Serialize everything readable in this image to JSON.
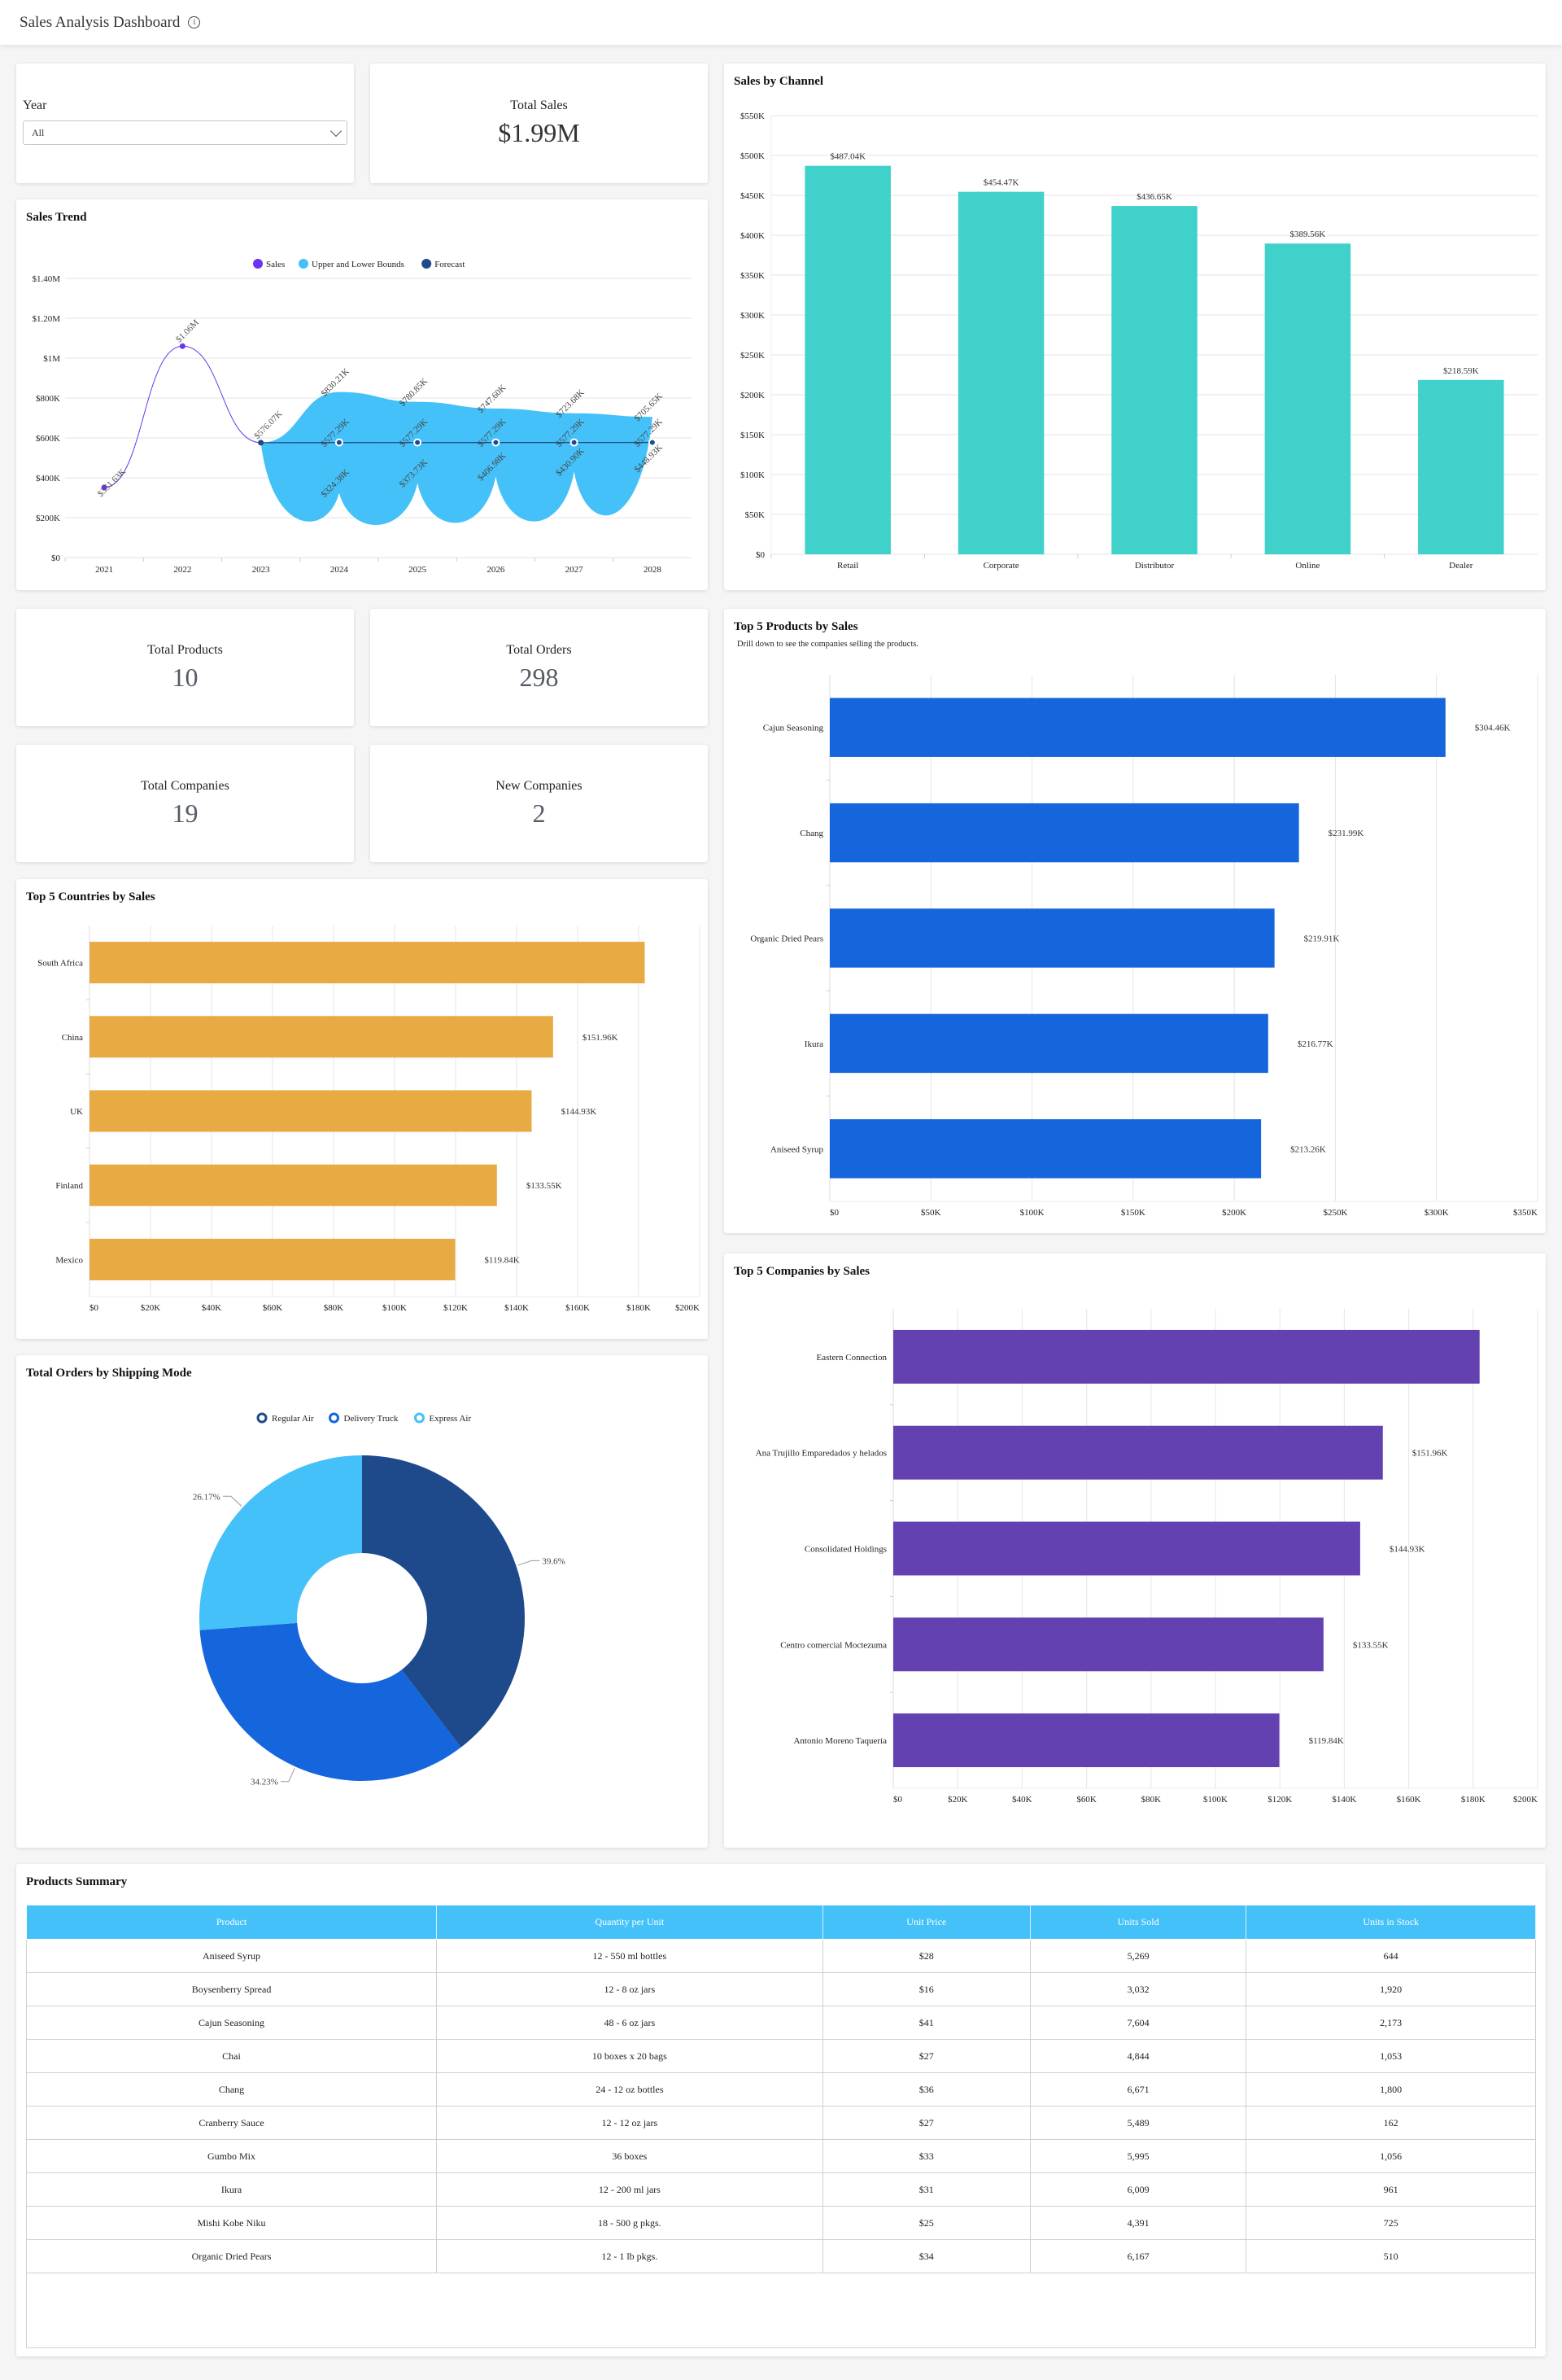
{
  "header": {
    "title": "Sales Analysis Dashboard",
    "info_icon": "info-icon"
  },
  "filter": {
    "label": "Year",
    "selected": "All"
  },
  "kpis": {
    "total_sales": {
      "label": "Total Sales",
      "value": "$1.99M"
    },
    "total_products": {
      "label": "Total Products",
      "value": "10"
    },
    "total_orders": {
      "label": "Total Orders",
      "value": "298"
    },
    "total_companies": {
      "label": "Total Companies",
      "value": "19"
    },
    "new_companies": {
      "label": "New Companies",
      "value": "2"
    }
  },
  "cards": {
    "sales_trend": "Sales Trend",
    "sales_by_channel": "Sales by Channel",
    "top_countries": "Top 5 Countries by Sales",
    "top_products": "Top 5 Products by Sales",
    "top_products_sub": "Drill down to see the companies selling the products.",
    "top_companies": "Top 5 Companies by Sales",
    "shipping_mode": "Total Orders by Shipping Mode",
    "products_summary": "Products Summary"
  },
  "colors": {
    "sales": "#6a35f0",
    "bounds": "#44c1f8",
    "forecast": "#1e4a8c",
    "channel": "#40d1cb",
    "countries": "#e8aa42",
    "products": "#1565dd",
    "companies": "#6441b0",
    "regular_air": "#1e4a8c",
    "delivery_truck": "#1565dd",
    "express_air": "#44c1f8",
    "table_header": "#44c1f8"
  },
  "chart_data": [
    {
      "id": "sales_trend",
      "type": "line",
      "title": "Sales Trend",
      "x": [
        "2021",
        "2022",
        "2023",
        "2024",
        "2025",
        "2026",
        "2027",
        "2028"
      ],
      "ylim": [
        0,
        1400000
      ],
      "yticks": [
        "$0",
        "$200K",
        "$400K",
        "$600K",
        "$800K",
        "$1M",
        "$1.20M",
        "$1.40M"
      ],
      "legend": [
        "Sales",
        "Upper and Lower Bounds",
        "Forecast"
      ],
      "legend_position": "top-center",
      "series": [
        {
          "name": "Sales",
          "values": [
            351630,
            1060000,
            576070,
            null,
            null,
            null,
            null,
            null
          ],
          "labels": [
            "$351.63K",
            "$1.06M",
            "$576.07K",
            "",
            "",
            "",
            "",
            ""
          ]
        },
        {
          "name": "Forecast",
          "values": [
            null,
            null,
            576070,
            577290,
            577290,
            577290,
            577290,
            577290
          ],
          "labels": [
            "",
            "",
            "",
            "$577.29K",
            "$577.29K",
            "$577.29K",
            "$577.29K",
            "$577.29K"
          ]
        },
        {
          "name": "Upper Bound",
          "values": [
            null,
            null,
            576070,
            830210,
            780850,
            747600,
            723680,
            705650
          ],
          "labels": [
            "",
            "",
            "",
            "$830.21K",
            "$780.85K",
            "$747.60K",
            "$723.68K",
            "$705.65K"
          ]
        },
        {
          "name": "Lower Bound",
          "values": [
            null,
            null,
            576070,
            324380,
            373730,
            406980,
            430900,
            448930
          ],
          "labels": [
            "",
            "",
            "",
            "$324.38K",
            "$373.73K",
            "$406.98K",
            "$430.90K",
            "$448.93K"
          ]
        }
      ]
    },
    {
      "id": "sales_by_channel",
      "type": "bar",
      "title": "Sales by Channel",
      "categories": [
        "Retail",
        "Corporate",
        "Distributor",
        "Online",
        "Dealer"
      ],
      "values": [
        487040,
        454470,
        436650,
        389560,
        218590
      ],
      "labels": [
        "$487.04K",
        "$454.47K",
        "$436.65K",
        "$389.56K",
        "$218.59K"
      ],
      "ylim": [
        0,
        550000
      ],
      "yticks": [
        "$0",
        "$50K",
        "$100K",
        "$150K",
        "$200K",
        "$250K",
        "$300K",
        "$350K",
        "$400K",
        "$450K",
        "$500K",
        "$550K"
      ]
    },
    {
      "id": "top_countries",
      "type": "bar",
      "orientation": "horizontal",
      "title": "Top 5 Countries by Sales",
      "categories": [
        "South Africa",
        "China",
        "UK",
        "Finland",
        "Mexico"
      ],
      "values": [
        182000,
        151960,
        144930,
        133550,
        119840
      ],
      "labels": [
        "",
        "$151.96K",
        "$144.93K",
        "$133.55K",
        "$119.84K"
      ],
      "xlim": [
        0,
        200000
      ],
      "xticks": [
        "$0",
        "$20K",
        "$40K",
        "$60K",
        "$80K",
        "$100K",
        "$120K",
        "$140K",
        "$160K",
        "$180K",
        "$200K"
      ]
    },
    {
      "id": "top_products",
      "type": "bar",
      "orientation": "horizontal",
      "title": "Top 5 Products by Sales",
      "categories": [
        "Cajun Seasoning",
        "Chang",
        "Organic Dried Pears",
        "Ikura",
        "Aniseed Syrup"
      ],
      "values": [
        304460,
        231990,
        219910,
        216770,
        213260
      ],
      "labels": [
        "$304.46K",
        "$231.99K",
        "$219.91K",
        "$216.77K",
        "$213.26K"
      ],
      "xlim": [
        0,
        350000
      ],
      "xticks": [
        "$0",
        "$50K",
        "$100K",
        "$150K",
        "$200K",
        "$250K",
        "$300K",
        "$350K"
      ]
    },
    {
      "id": "top_companies",
      "type": "bar",
      "orientation": "horizontal",
      "title": "Top 5 Companies by Sales",
      "categories": [
        "Eastern Connection",
        "Ana Trujillo Emparedados y helados",
        "Consolidated Holdings",
        "Centro comercial Moctezuma",
        "Antonio Moreno Taquería"
      ],
      "values": [
        182000,
        151960,
        144930,
        133550,
        119840
      ],
      "labels": [
        "",
        "$151.96K",
        "$144.93K",
        "$133.55K",
        "$119.84K"
      ],
      "xlim": [
        0,
        200000
      ],
      "xticks": [
        "$0",
        "$20K",
        "$40K",
        "$60K",
        "$80K",
        "$100K",
        "$120K",
        "$140K",
        "$160K",
        "$180K",
        "$200K"
      ]
    },
    {
      "id": "shipping_mode",
      "type": "pie",
      "donut": true,
      "title": "Total Orders by Shipping Mode",
      "categories": [
        "Regular Air",
        "Delivery Truck",
        "Express Air"
      ],
      "values": [
        39.6,
        34.23,
        26.17
      ],
      "labels": [
        "39.6%",
        "34.23%",
        "26.17%"
      ],
      "legend_position": "top-center"
    }
  ],
  "table": {
    "columns": [
      "Product",
      "Quantity per Unit",
      "Unit Price",
      "Units Sold",
      "Units in Stock"
    ],
    "rows": [
      [
        "Aniseed Syrup",
        "12 - 550 ml bottles",
        "$28",
        "5,269",
        "644"
      ],
      [
        "Boysenberry Spread",
        "12 - 8 oz jars",
        "$16",
        "3,032",
        "1,920"
      ],
      [
        "Cajun Seasoning",
        "48 - 6 oz jars",
        "$41",
        "7,604",
        "2,173"
      ],
      [
        "Chai",
        "10 boxes x 20 bags",
        "$27",
        "4,844",
        "1,053"
      ],
      [
        "Chang",
        "24 - 12 oz bottles",
        "$36",
        "6,671",
        "1,800"
      ],
      [
        "Cranberry Sauce",
        "12 - 12 oz jars",
        "$27",
        "5,489",
        "162"
      ],
      [
        "Gumbo Mix",
        "36 boxes",
        "$33",
        "5,995",
        "1,056"
      ],
      [
        "Ikura",
        "12 - 200 ml jars",
        "$31",
        "6,009",
        "961"
      ],
      [
        "Mishi Kobe Niku",
        "18 - 500 g pkgs.",
        "$25",
        "4,391",
        "725"
      ],
      [
        "Organic Dried Pears",
        "12 - 1 lb pkgs.",
        "$34",
        "6,167",
        "510"
      ]
    ]
  }
}
